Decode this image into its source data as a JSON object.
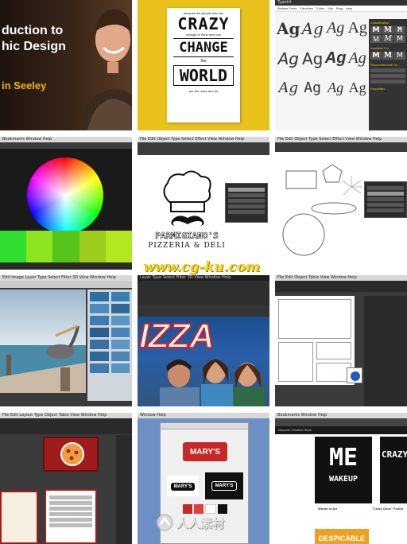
{
  "tiles": {
    "intro": {
      "title_line1": "duction to",
      "title_line2": "hic Design",
      "presenter": "in Seeley"
    },
    "poster": {
      "top_small": "because the people who are",
      "word1": "CRAZY",
      "mid_small1": "enough to think they can",
      "word2": "CHANGE",
      "mid_small2": "the",
      "word3": "WORLD",
      "bottom_small": "are the ones who do"
    },
    "typekit": {
      "brand": "Typekit",
      "nav": [
        "Browse Fonts",
        "Favorites",
        "Editor",
        "Kits",
        "Blog",
        "Help"
      ],
      "sidebar_header": "Classification",
      "sidebar_header2": "Available For",
      "sidebar_header3": "Recommended For",
      "sidebar_header4": "Properties",
      "sample_glyphs": [
        "Ag",
        "Ag",
        "Ag",
        "Ag",
        "Ag",
        "Ag",
        "Ag",
        "Ag",
        "Ag",
        "Ag",
        "Ag",
        "Ag"
      ],
      "sidebar_glyphs": [
        "M",
        "M",
        "M",
        "M",
        "M",
        "M",
        "M",
        "M",
        "M"
      ]
    },
    "color_picker": {
      "menubar": "Bookmarks  Window  Help"
    },
    "pizzeria": {
      "menubar": "File  Edit  Object  Type  Select  Effect  View  Window  Help",
      "brand_name": "PARMIGIANO'S",
      "tagline": "PIZZERIA & DELI",
      "layer_items": [
        "Artboard",
        "Symbol",
        "Text",
        "Mustache",
        "Hat"
      ]
    },
    "shapes": {
      "menubar": "File  Edit  Object  Type  Select  Effect  View  Window  Help",
      "layer_items": [
        "Polygon",
        "Star",
        "Ellipse",
        "Rectangle",
        "Ellipse",
        "Group"
      ]
    },
    "pelican": {
      "menubar": "Edit  Image  Layer  Type  Select  Filter  3D  View  Window  Help"
    },
    "pizza_photo": {
      "menubar": "Layer  Type  Select  Filter  3D  View  Window  Help",
      "headline": "IZZA"
    },
    "layout_grid": {
      "menubar": "File  Edit  Object  Table  View  Window  Help"
    },
    "menu_design": {
      "menubar": "File  Edit  Layout  Type  Object  Table  View  Window  Help"
    },
    "marys": {
      "menubar": "Window  Help",
      "brand": "MARY'S",
      "brand_small": "MARY'S"
    },
    "posters_site": {
      "menubar": "Bookmarks  Window  Help",
      "nav_title": "Discover Creative Work",
      "poster_me": "ME",
      "poster_wake": "WAKEUP",
      "poster_crazy": "CRAZY",
      "caption1": "Words of Art",
      "caption2": "\"Crazy Ones\" Poster",
      "logo_text": "DESPICABLE"
    }
  },
  "watermarks": {
    "center": "www.cg-ku.com",
    "bottom": "人人素材"
  },
  "colors": {
    "poster_yellow": "#e8c21a",
    "intro_bg": "#2a1d14",
    "intro_accent": "#f0b400",
    "pizza_red": "#c62828",
    "dark_ui": "#2b2b2b",
    "watermark_yellow": "#f3d21c"
  }
}
